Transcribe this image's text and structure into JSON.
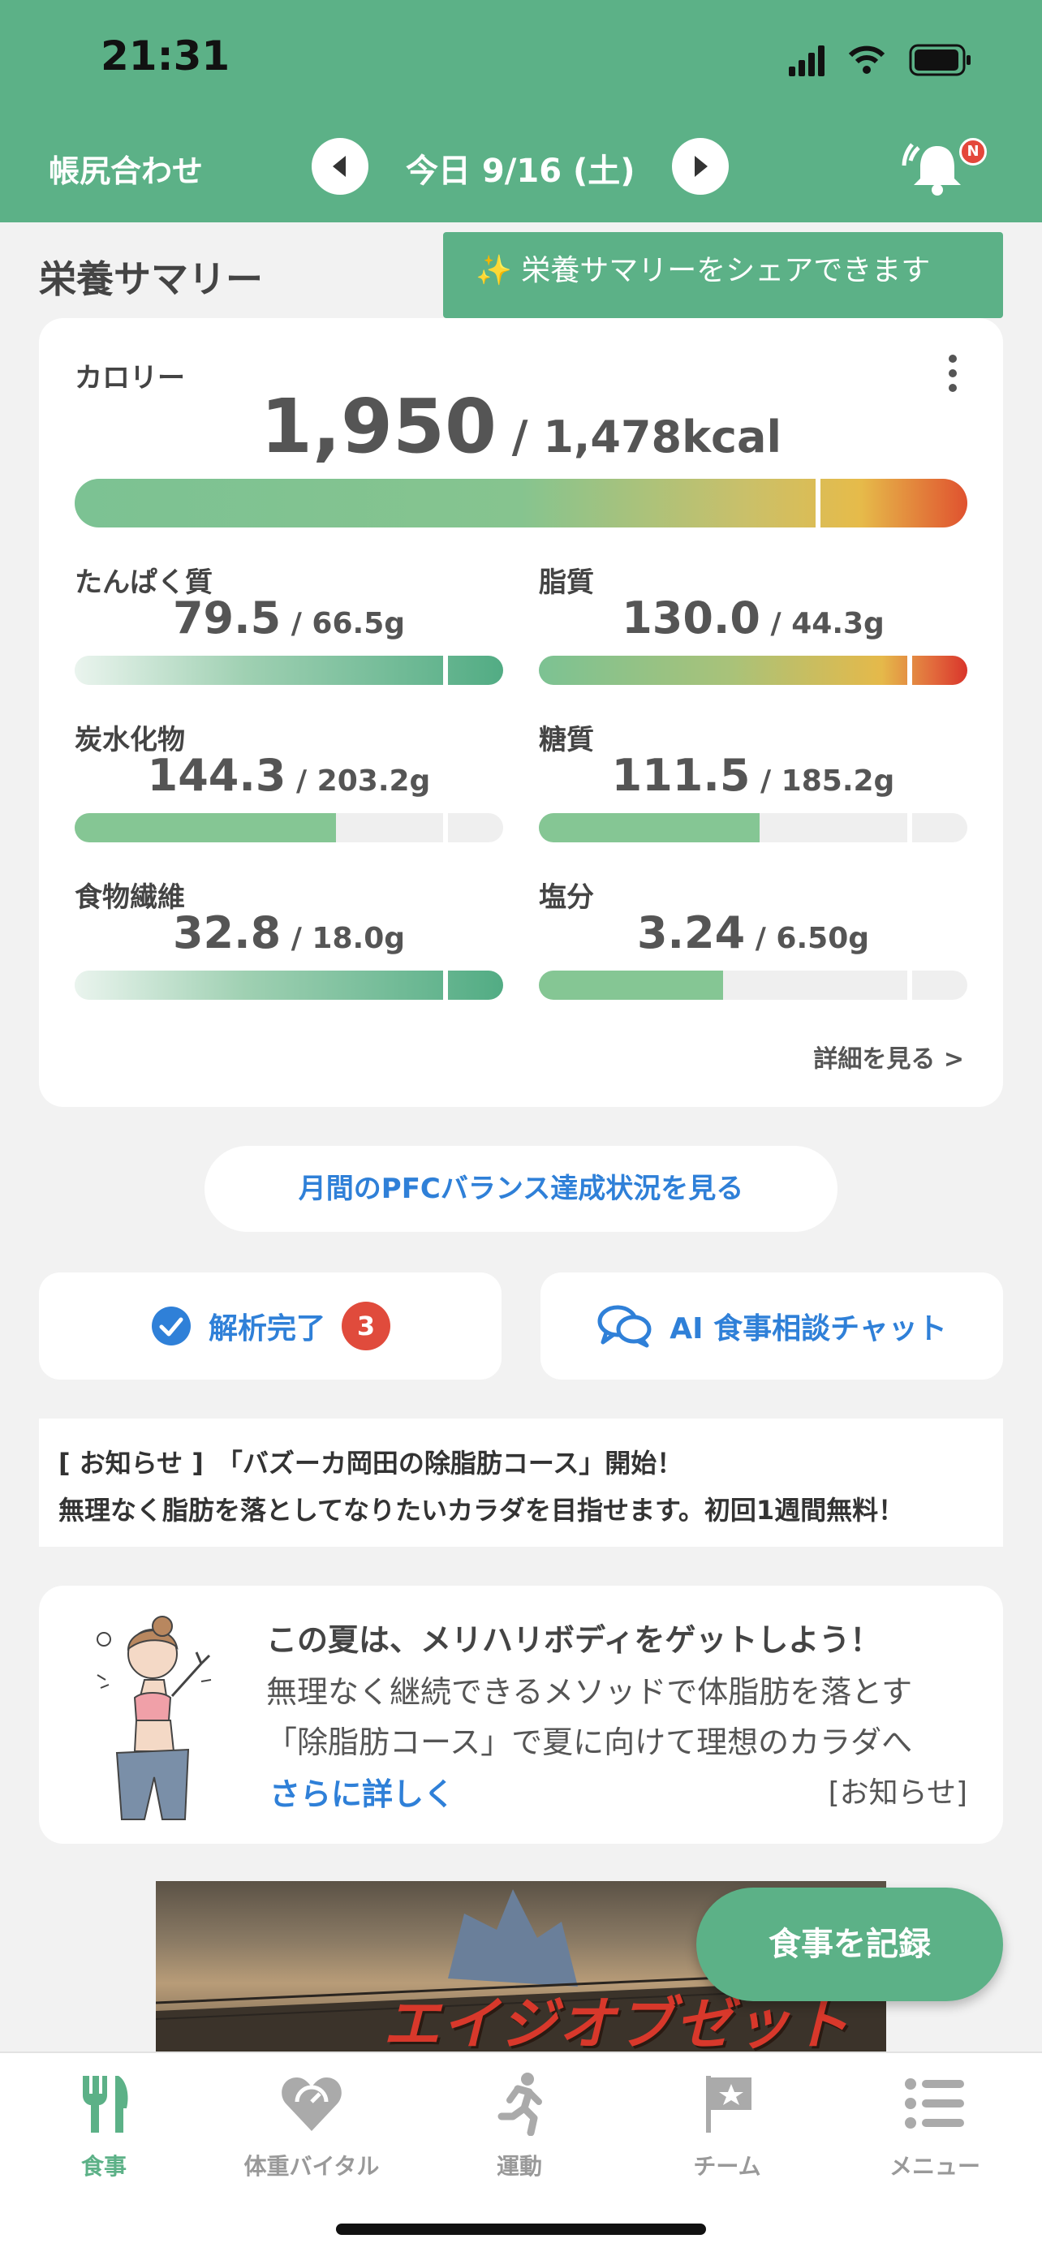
{
  "status": {
    "time": "21:31"
  },
  "header": {
    "left_label": "帳尻合わせ",
    "date": "今日 9/16 (土)",
    "bell_badge": "N"
  },
  "summary": {
    "title": "栄養サマリー",
    "share_tip": "✨ 栄養サマリーをシェアできます",
    "calorie": {
      "label": "カロリー",
      "value": "1,950",
      "target": " / 1,478kcal",
      "ratio": 1.32
    },
    "nutrients": [
      {
        "label": "たんぱく質",
        "value": "79.5",
        "target": " / 66.5g",
        "ratio": 1.2
      },
      {
        "label": "脂質",
        "value": "130.0",
        "target": " / 44.3g",
        "ratio": 2.93
      },
      {
        "label": "炭水化物",
        "value": "144.3",
        "target": " / 203.2g",
        "ratio": 0.71
      },
      {
        "label": "糖質",
        "value": "111.5",
        "target": " / 185.2g",
        "ratio": 0.6
      },
      {
        "label": "食物繊維",
        "value": "32.8",
        "target": " / 18.0g",
        "ratio": 1.82
      },
      {
        "label": "塩分",
        "value": "3.24",
        "target": " / 6.50g",
        "ratio": 0.5
      }
    ],
    "detail_link": "詳細を見る >"
  },
  "pfc_button": "月間のPFCバランス達成状況を見る",
  "analysis": {
    "label": "解析完了",
    "count": "3"
  },
  "ai_chat": "AI 食事相談チャット",
  "notice": {
    "line1": "[ お知らせ ]　「バズーカ岡田の除脂肪コース」開始！",
    "line2": "無理なく脂肪を落としてなりたいカラダを目指せます。初回1週間無料！"
  },
  "promo": {
    "title": "この夏は、メリハリボディをゲットしよう！",
    "line1": "無理なく継続できるメソッドで体脂肪を落とす",
    "line2": "「除脂肪コース」で夏に向けて理想のカラダへ",
    "link": "さらに詳しく",
    "tag": "[お知らせ]"
  },
  "banner": {
    "title": "エイジオブゼット"
  },
  "fab": "食事を記録",
  "tabs": [
    {
      "label": "食事",
      "icon": "fork-knife-icon"
    },
    {
      "label": "体重バイタル",
      "icon": "heart-scale-icon"
    },
    {
      "label": "運動",
      "icon": "running-icon"
    },
    {
      "label": "チーム",
      "icon": "flag-icon"
    },
    {
      "label": "メニュー",
      "icon": "menu-list-icon"
    }
  ],
  "colors": {
    "brand": "#5cb187",
    "link": "#2f80d8",
    "alert": "#e04b3c"
  }
}
